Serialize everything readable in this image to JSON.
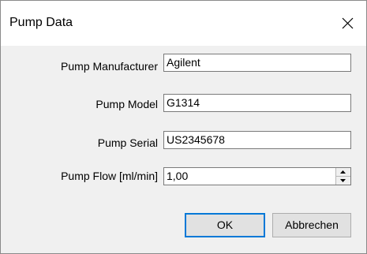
{
  "dialog": {
    "title": "Pump Data",
    "close_icon": "close-icon"
  },
  "form": {
    "fields": [
      {
        "label": "Pump Manufacturer",
        "value": "Agilent"
      },
      {
        "label": "Pump Model",
        "value": "G1314"
      },
      {
        "label": "Pump Serial",
        "value": "US2345678"
      },
      {
        "label": "Pump Flow [ml/min]",
        "value": "1,00"
      }
    ]
  },
  "buttons": {
    "ok_label": "OK",
    "cancel_label": "Abbrechen"
  },
  "colors": {
    "focus_border": "#0078d7",
    "dialog_bg": "#f0f0f0"
  }
}
